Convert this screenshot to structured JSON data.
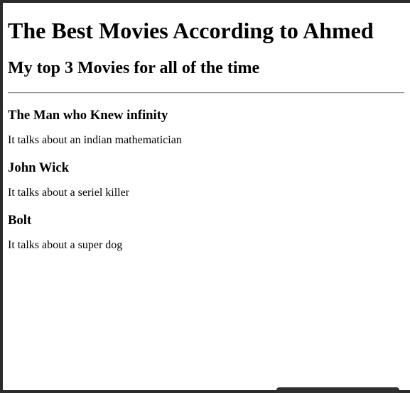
{
  "page": {
    "heading": "The Best Movies According to Ahmed",
    "subheading": "My top 3 Movies for all of the time"
  },
  "movies": [
    {
      "title": "The Man who Knew infinity",
      "description": "It talks about an indian mathematician"
    },
    {
      "title": "John Wick",
      "description": "It talks about a seriel killer"
    },
    {
      "title": "Bolt",
      "description": "It talks about a super dog"
    }
  ]
}
